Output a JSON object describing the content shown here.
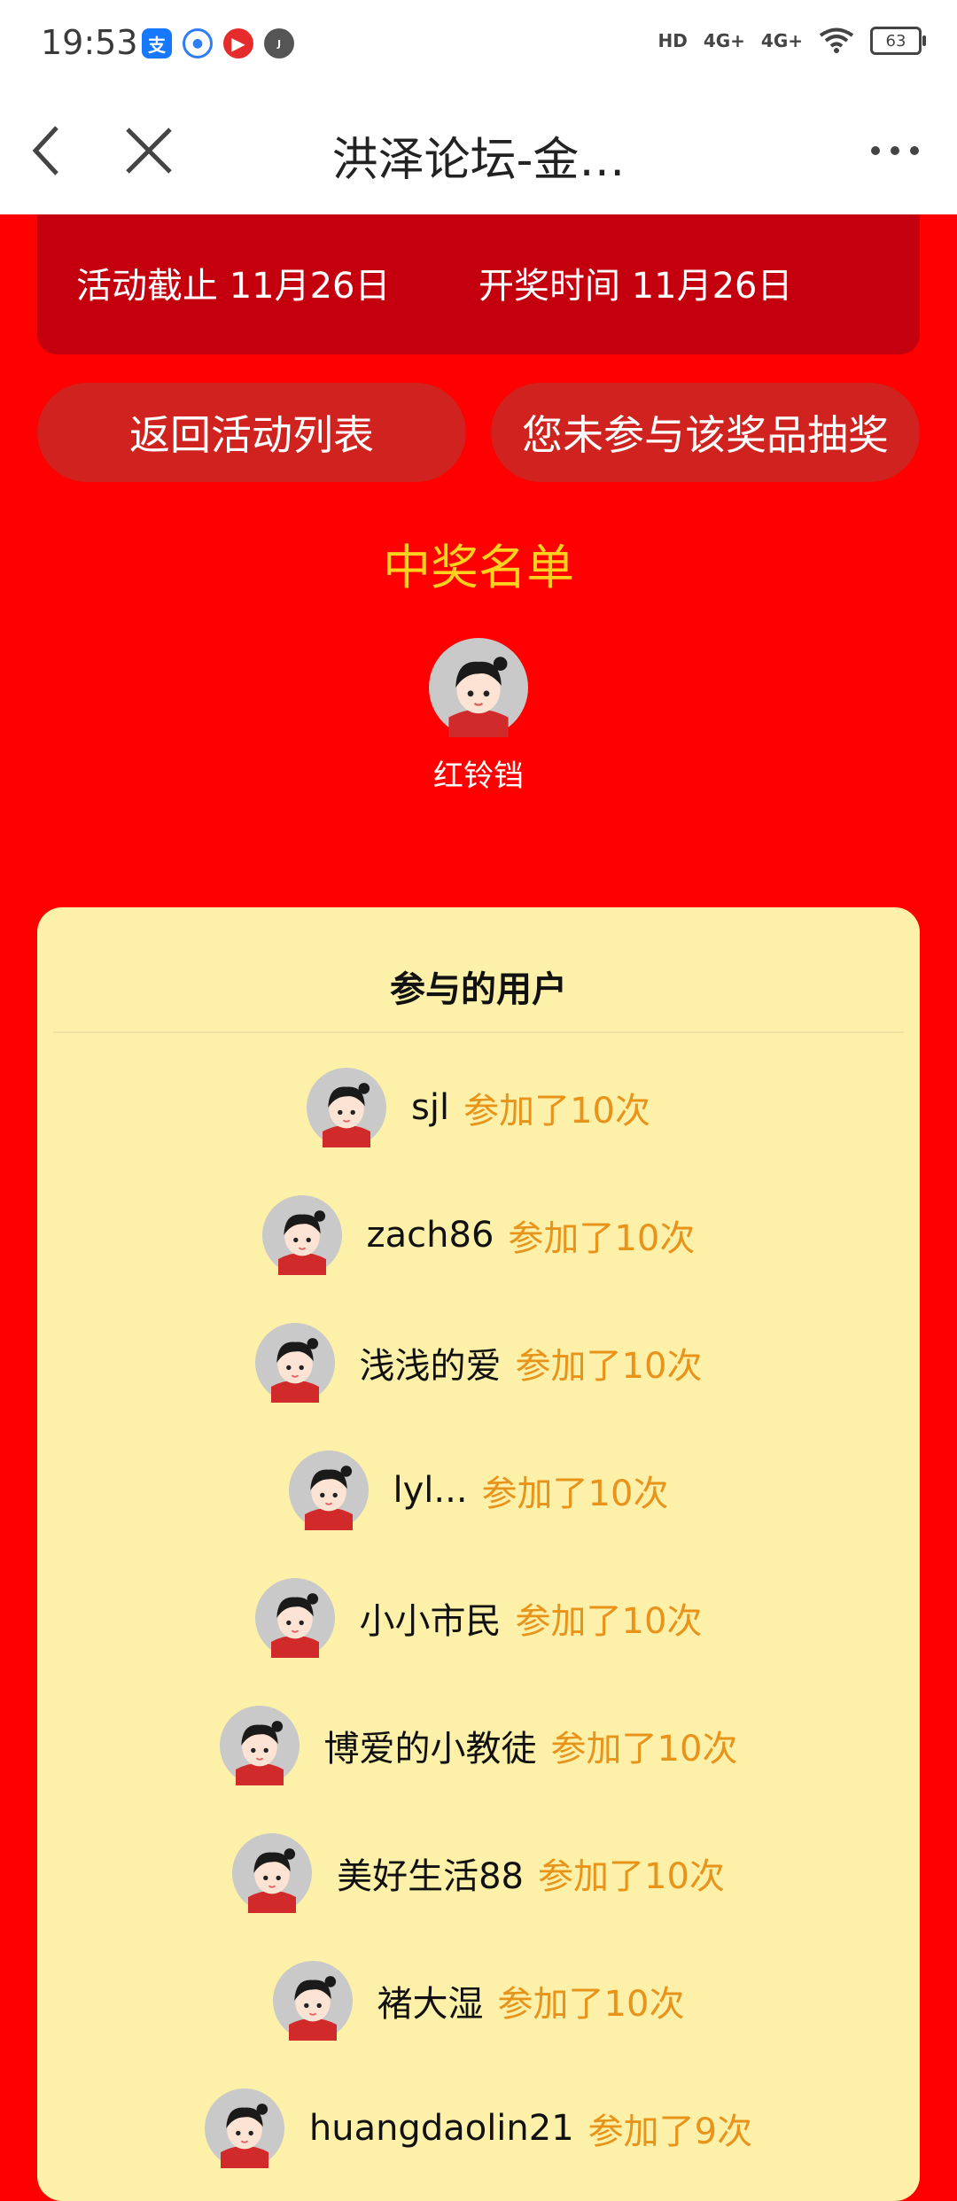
{
  "status_bar": {
    "time": "19:53",
    "network_1": "HD",
    "network_2": "4G+",
    "network_3": "4G+",
    "battery": "63"
  },
  "nav": {
    "title": "洪泽论坛-金…"
  },
  "info": {
    "deadline": "活动截止 11月26日",
    "draw_time": "开奖时间 11月26日"
  },
  "buttons": {
    "back_to_list": "返回活动列表",
    "not_participated": "您未参与该奖品抽奖"
  },
  "winners": {
    "title": "中奖名单",
    "names": [
      "红铃铛"
    ]
  },
  "participants": {
    "title": "参与的用户",
    "users": [
      {
        "name": "sjl",
        "count": "参加了10次"
      },
      {
        "name": "zach86",
        "count": "参加了10次"
      },
      {
        "name": "浅浅的爱",
        "count": "参加了10次"
      },
      {
        "name": "lyl...",
        "count": "参加了10次"
      },
      {
        "name": "小小市民",
        "count": "参加了10次"
      },
      {
        "name": "博爱的小教徒",
        "count": "参加了10次"
      },
      {
        "name": "美好生活88",
        "count": "参加了10次"
      },
      {
        "name": "褚大湿",
        "count": "参加了10次"
      },
      {
        "name": "huangdaolin21",
        "count": "参加了9次"
      }
    ]
  }
}
